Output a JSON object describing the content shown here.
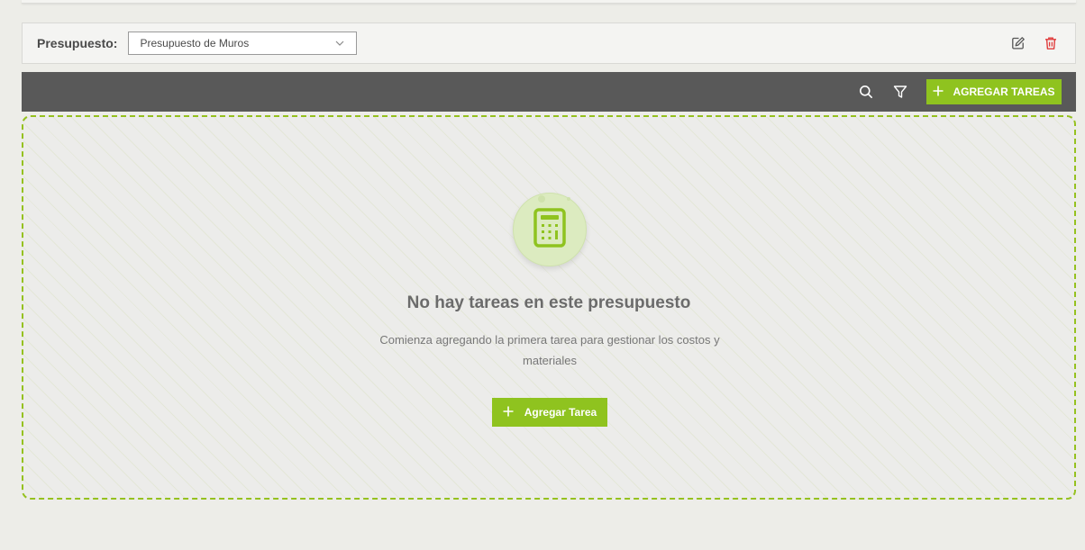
{
  "budget": {
    "label": "Presupuesto:",
    "selected": "Presupuesto de Muros"
  },
  "toolbar": {
    "add_tasks_label": "AGREGAR TAREAS"
  },
  "empty_state": {
    "title": "No hay tareas en este presupuesto",
    "description": "Comienza agregando la primera tarea para gestionar los costos y materiales",
    "button_label": "Agregar Tarea"
  },
  "icons": {
    "select_chevron": "chevron-down-icon",
    "edit": "edit-icon",
    "delete": "trash-icon",
    "search": "search-icon",
    "filter": "filter-icon",
    "add": "plus-icon",
    "empty": "calculator-icon"
  },
  "colors": {
    "accent": "#8fc31f",
    "toolbar_bg": "#595959",
    "delete": "#e03c3c",
    "page_bg": "#edede8"
  }
}
